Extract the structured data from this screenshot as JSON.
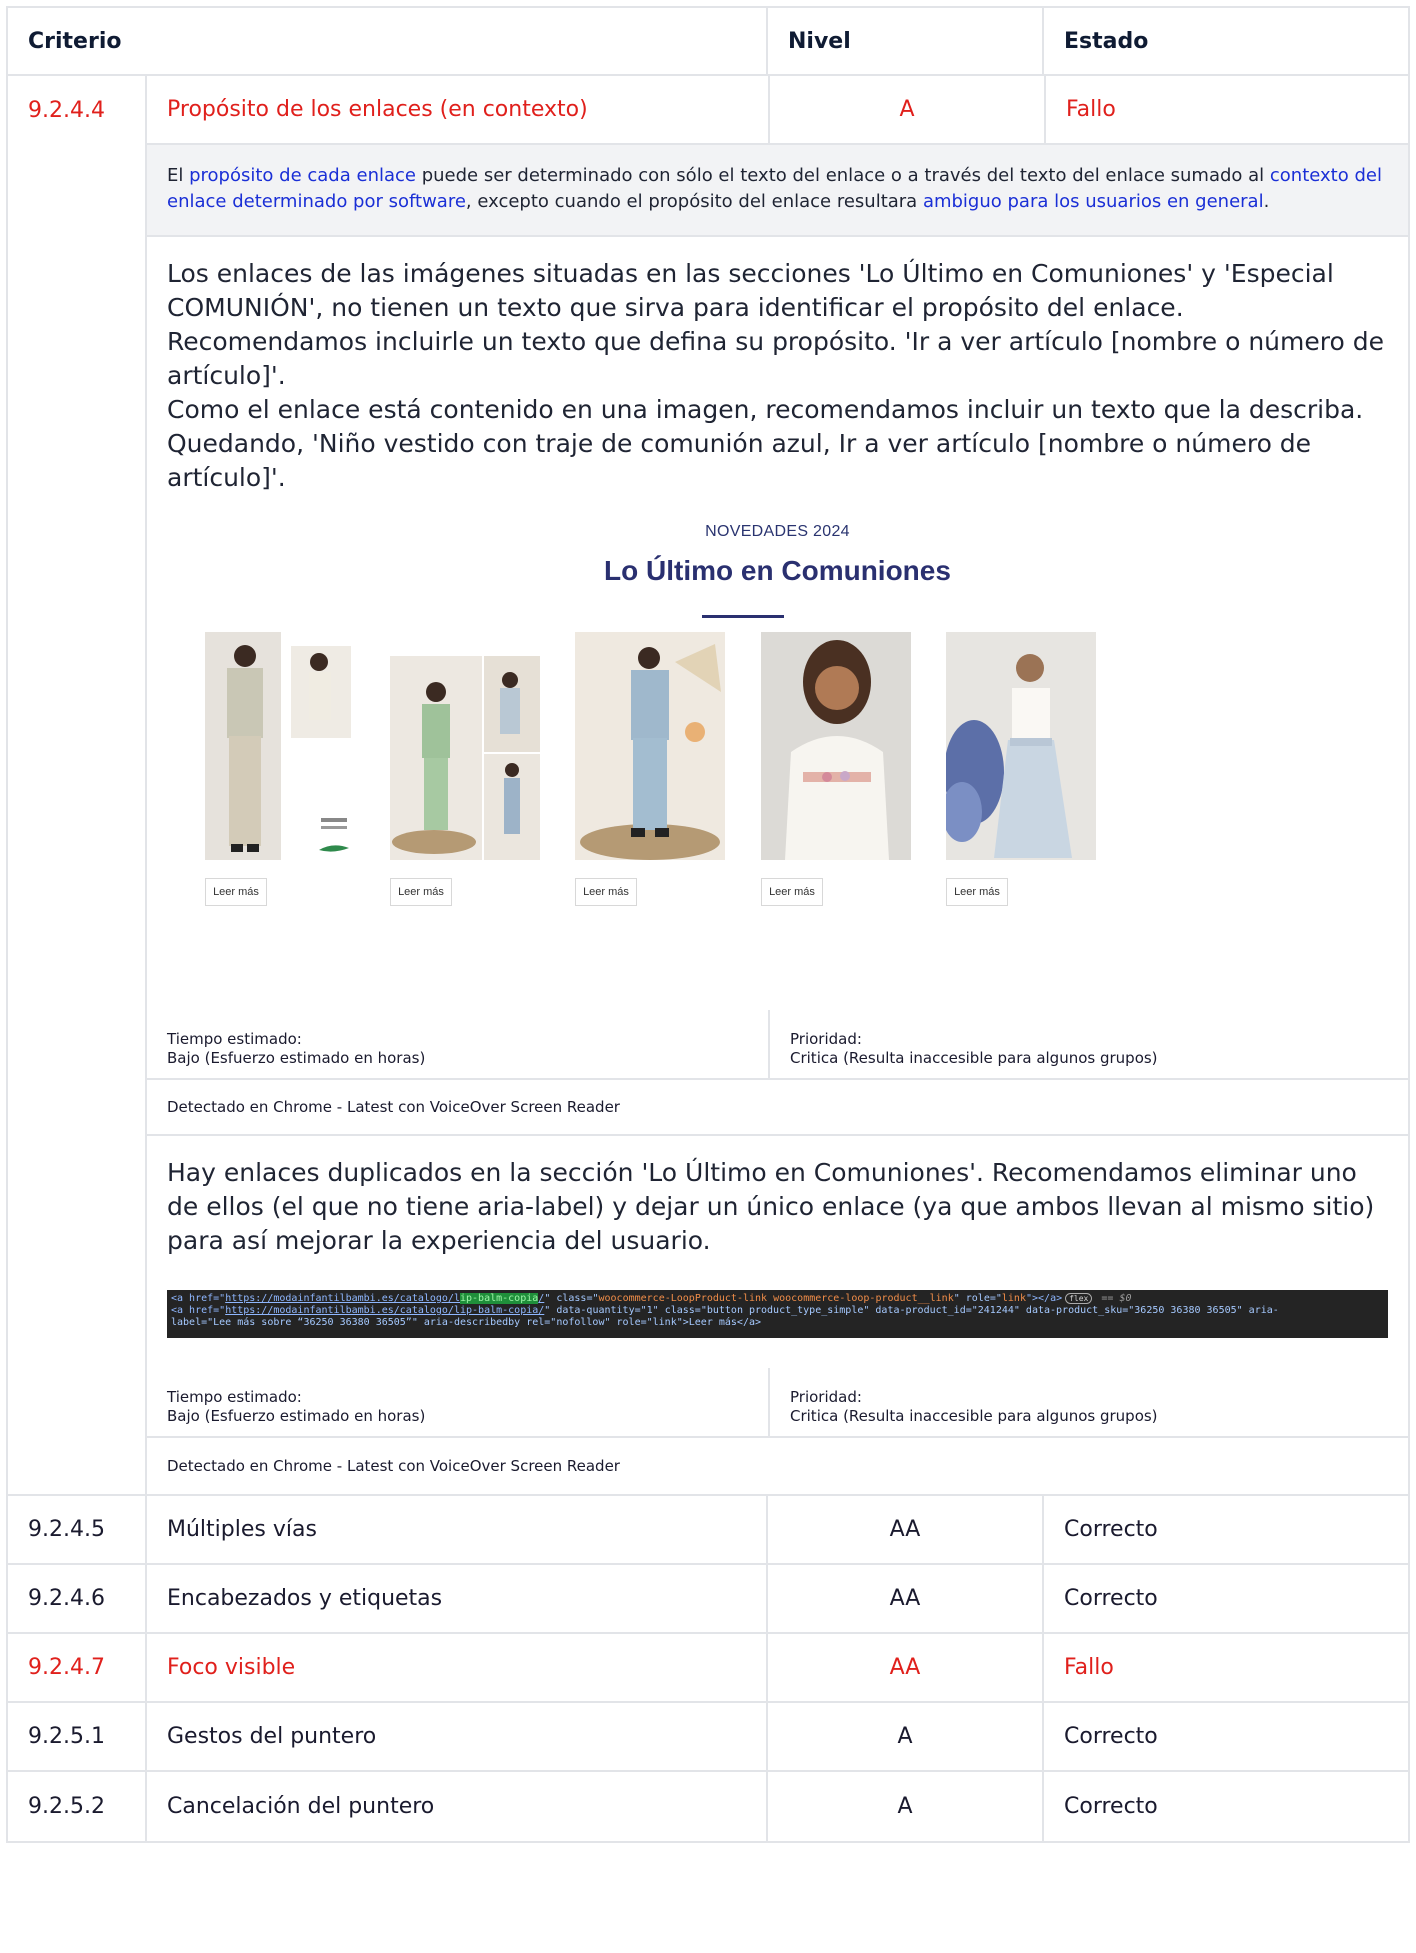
{
  "header": {
    "criterio": "Criterio",
    "nivel": "Nivel",
    "estado": "Estado"
  },
  "expanded": {
    "id": "9.2.4.4",
    "name": "Propósito de los enlaces (en contexto)",
    "level": "A",
    "status": "Fallo",
    "description": {
      "t1": "El ",
      "l1": "propósito de cada enlace",
      "t2": " puede ser determinado con sólo el texto del enlace o a través del texto del enlace sumado al ",
      "l2": "contexto del enlace determinado por software",
      "t3": ", excepto cuando el propósito del enlace resultara ",
      "l3": "ambiguo para los usuarios en general",
      "t4": "."
    },
    "finding1": {
      "lines": [
        "Los enlaces de las imágenes situadas en las secciones 'Lo Último en Comuniones' y 'Especial COMUNIÓN', no tienen un texto que sirva para identificar el propósito del enlace.",
        "Recomendamos incluirle un texto que defina su propósito. 'Ir a ver artículo [nombre o número de artículo]'.",
        "Como el enlace está contenido en una imagen, recomendamos incluir un texto que la describa. Quedando, 'Niño vestido con traje de comunión azul, Ir a ver artículo [nombre o número de artículo]'."
      ]
    },
    "screenshot": {
      "subtitle": "NOVEDADES 2024",
      "title": "Lo Último en Comuniones",
      "read_more": "Leer más"
    },
    "meta": {
      "time_label": "Tiempo estimado:",
      "time_value": "Bajo (Esfuerzo estimado en horas)",
      "priority_label": "Prioridad:",
      "priority_value": "Critica (Resulta inaccesible para algunos grupos)"
    },
    "detected": "Detectado en Chrome - Latest con VoiceOver Screen Reader",
    "finding2": "Hay enlaces duplicados en la sección 'Lo Último en Comuniones'. Recomendamos eliminar uno de ellos (el que no tiene aria-label) y dejar un único enlace (ya que ambos llevan al mismo sitio) para así mejorar la experiencia del usuario.",
    "code": {
      "line1_a": "<a href=\"",
      "line1_url_a": "https://modainfantilbambi.es/catalogo/l",
      "line1_hl": "ip-balm-copia",
      "line1_url_b": "/",
      "line1_b": "\" class=\"",
      "line1_class": "woocommerce-LoopProduct-link woocommerce-loop-product__link",
      "line1_c": "\" role=\"",
      "line1_role": "link",
      "line1_d": "\"></a>",
      "line1_flex": "flex",
      "line1_e": " == $0",
      "line2_a": "<a href=\"",
      "line2_url": "https://modainfantilbambi.es/catalogo/lip-balm-copia/",
      "line2_b": "\" data-quantity=\"1\" class=\"button product_type_simple\" data-product_id=\"241244\" data-product_sku=\"36250 36380 36505\" aria-",
      "line3": "label=\"Lee más sobre “36250 36380 36505”\" aria-describedby rel=\"nofollow\" role=\"link\">Leer más</a>"
    }
  },
  "rows": [
    {
      "id": "9.2.4.5",
      "name": "Múltiples vías",
      "level": "AA",
      "status": "Correcto",
      "fail": false
    },
    {
      "id": "9.2.4.6",
      "name": "Encabezados y etiquetas",
      "level": "AA",
      "status": "Correcto",
      "fail": false
    },
    {
      "id": "9.2.4.7",
      "name": "Foco visible",
      "level": "AA",
      "status": "Fallo",
      "fail": true
    },
    {
      "id": "9.2.5.1",
      "name": "Gestos del puntero",
      "level": "A",
      "status": "Correcto",
      "fail": false
    },
    {
      "id": "9.2.5.2",
      "name": "Cancelación del puntero",
      "level": "A",
      "status": "Correcto",
      "fail": false
    }
  ],
  "colors": {
    "fail": "#e0201c",
    "link": "#1a2fd6",
    "border": "#e2e4e8"
  }
}
